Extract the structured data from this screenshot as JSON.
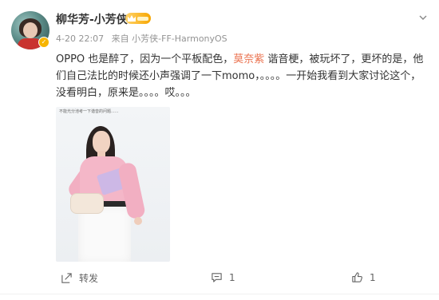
{
  "post": {
    "username": "柳华芳-小芳侠",
    "meta": {
      "time": "4-20 22:07",
      "source": "来自 小芳侠-FF-HarmonyOS"
    },
    "content": {
      "part1": "OPPO 也是醉了，因为一个平板配色，",
      "highlight": "莫奈紫",
      "part2": " 谐音梗，被玩坏了，更坏的是，他们自己法比的时候还小声强调了一下momo，。。。。一开始我看到大家讨论这个，没看明白，原来是。。。。哎。。。"
    },
    "image_caption": "不能光分池考一下谐音的问题......"
  },
  "actions": {
    "forward_label": "转发",
    "comment_count": "1",
    "like_count": "1"
  },
  "colors": {
    "highlight": "#eb7350",
    "meta_gray": "#939393",
    "badge_gold": "#f7a600"
  },
  "icons": [
    "chevron-down-icon",
    "verified-badge-icon",
    "level-badge-icon",
    "forward-icon",
    "comment-icon",
    "like-icon"
  ]
}
